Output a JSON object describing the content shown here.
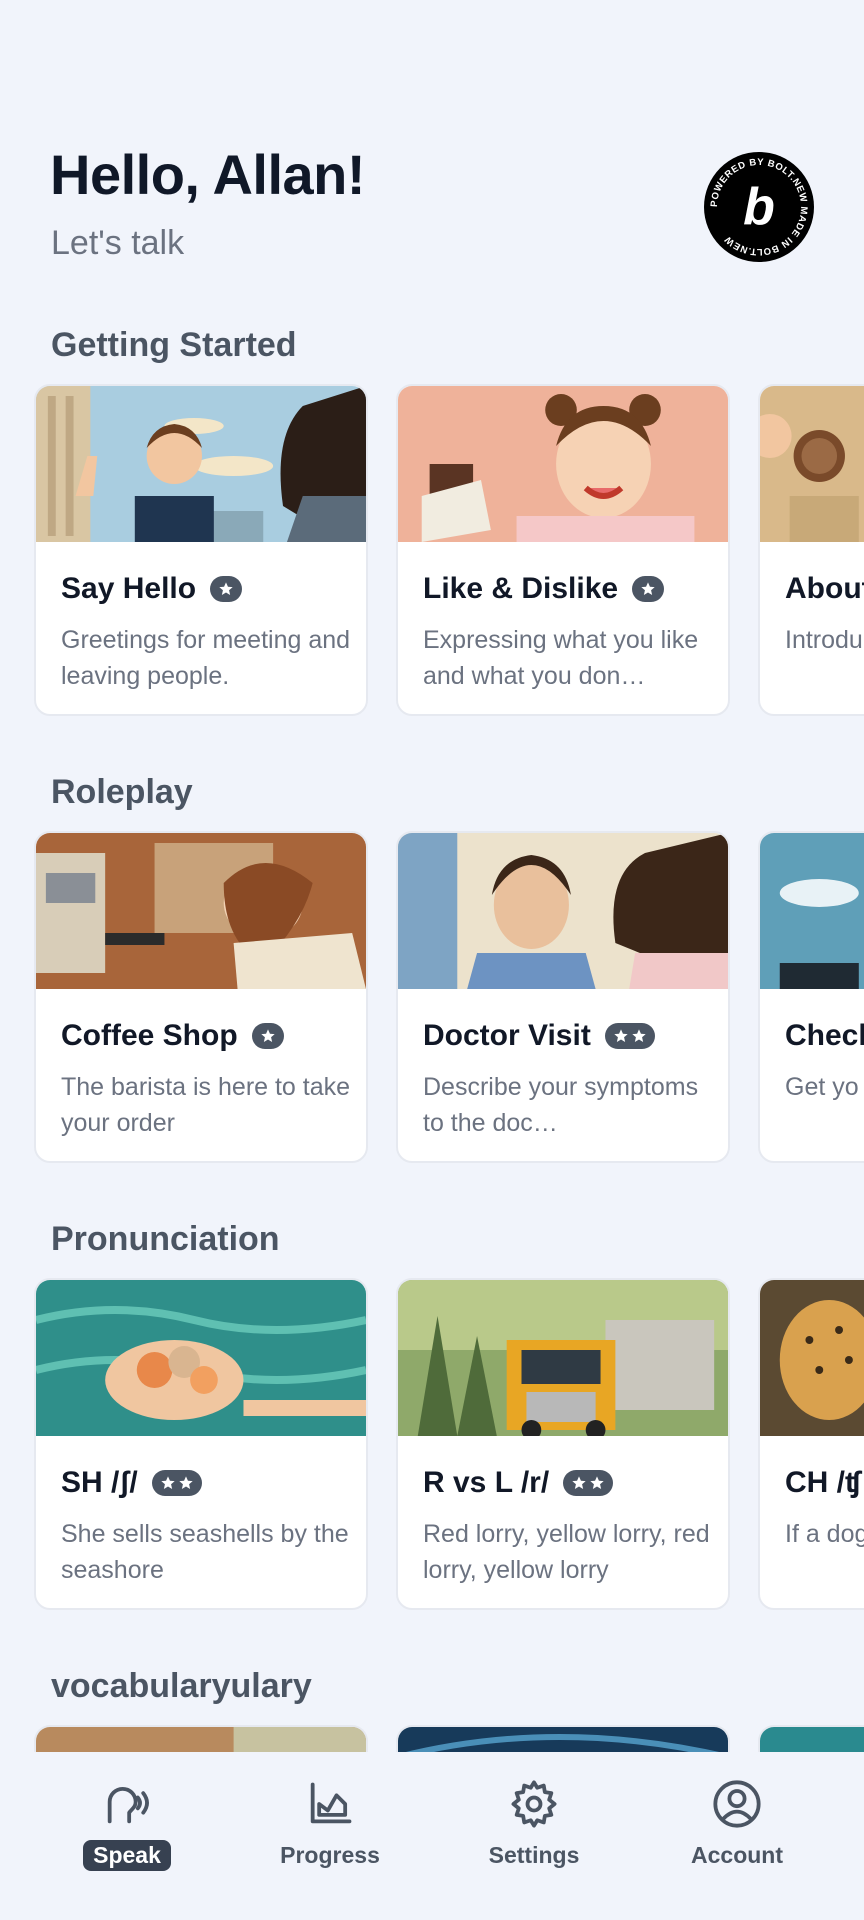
{
  "header": {
    "greeting": "Hello, Allan!",
    "subtitle": "Let's talk",
    "badge_text": "POWERED BY BOLT.NEW MADE IN BOLT.NEW",
    "badge_letter": "b"
  },
  "sections": [
    {
      "title": "Getting Started",
      "cards": [
        {
          "title": "Say Hello",
          "stars": 1,
          "description": "Greetings for meeting and leaving people."
        },
        {
          "title": "Like & Dislike",
          "stars": 1,
          "description": "Expressing what you like and what you don…"
        },
        {
          "title": "About",
          "stars": 0,
          "description": "Introdu name,"
        }
      ]
    },
    {
      "title": "Roleplay",
      "cards": [
        {
          "title": "Coffee Shop",
          "stars": 1,
          "description": "The barista is here to take your order"
        },
        {
          "title": "Doctor Visit",
          "stars": 2,
          "description": "Describe your symptoms to the doc…"
        },
        {
          "title": "Check",
          "stars": 0,
          "description": "Get yo pass fo"
        }
      ]
    },
    {
      "title": "Pronunciation",
      "cards": [
        {
          "title": "SH /ʃ/",
          "stars": 2,
          "description": "She sells seashells by the seashore"
        },
        {
          "title": "R vs L /r/",
          "stars": 2,
          "description": "Red lorry, yellow lorry, red lorry, yellow lorry"
        },
        {
          "title": "CH /ʧ",
          "stars": 0,
          "description": "If a dog whose"
        }
      ]
    },
    {
      "title": "vocabularyulary",
      "cards": []
    }
  ],
  "nav": {
    "items": [
      {
        "label": "Speak",
        "icon": "speak-icon",
        "active": true
      },
      {
        "label": "Progress",
        "icon": "chart-icon",
        "active": false
      },
      {
        "label": "Settings",
        "icon": "gear-icon",
        "active": false
      },
      {
        "label": "Account",
        "icon": "account-icon",
        "active": false
      }
    ]
  },
  "colors": {
    "background": "#f1f4fb",
    "text_primary": "#101828",
    "text_secondary": "#6b7280",
    "pill": "#4b5563",
    "nav_active": "#374151"
  }
}
